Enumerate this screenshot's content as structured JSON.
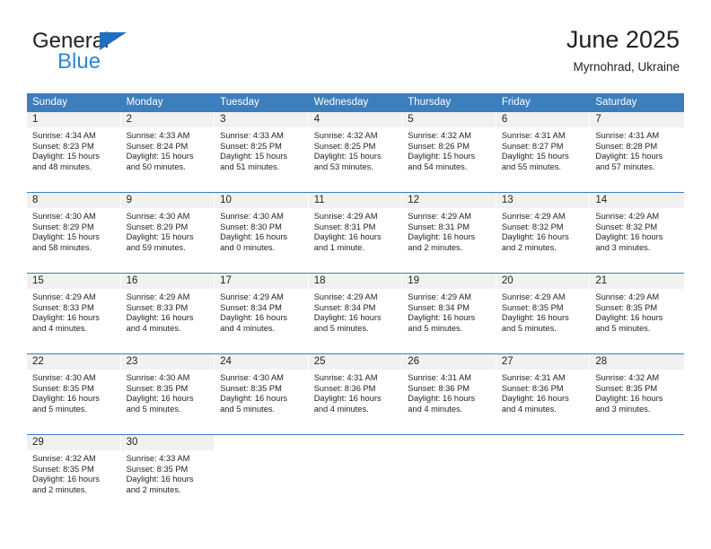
{
  "brand": {
    "name_part1": "General",
    "name_part2": "Blue",
    "triangle_icon": "brand-triangle-icon",
    "colors": {
      "dark": "#231f20",
      "blue": "#2e86d6",
      "triangle": "#1f6fc0"
    }
  },
  "header": {
    "title": "June 2025",
    "subtitle": "Myrnohrad, Ukraine"
  },
  "theme": {
    "header_blue": "#3d7ebd",
    "day_band_gray": "#f1f1f1",
    "text": "#231f20",
    "cell_background": "#ffffff"
  },
  "calendar": {
    "weekdays": [
      "Sunday",
      "Monday",
      "Tuesday",
      "Wednesday",
      "Thursday",
      "Friday",
      "Saturday"
    ],
    "weeks": [
      [
        {
          "day": "1",
          "sunrise": "Sunrise: 4:34 AM",
          "sunset": "Sunset: 8:23 PM",
          "daylight_line1": "Daylight: 15 hours",
          "daylight_line2": "and 48 minutes."
        },
        {
          "day": "2",
          "sunrise": "Sunrise: 4:33 AM",
          "sunset": "Sunset: 8:24 PM",
          "daylight_line1": "Daylight: 15 hours",
          "daylight_line2": "and 50 minutes."
        },
        {
          "day": "3",
          "sunrise": "Sunrise: 4:33 AM",
          "sunset": "Sunset: 8:25 PM",
          "daylight_line1": "Daylight: 15 hours",
          "daylight_line2": "and 51 minutes."
        },
        {
          "day": "4",
          "sunrise": "Sunrise: 4:32 AM",
          "sunset": "Sunset: 8:25 PM",
          "daylight_line1": "Daylight: 15 hours",
          "daylight_line2": "and 53 minutes."
        },
        {
          "day": "5",
          "sunrise": "Sunrise: 4:32 AM",
          "sunset": "Sunset: 8:26 PM",
          "daylight_line1": "Daylight: 15 hours",
          "daylight_line2": "and 54 minutes."
        },
        {
          "day": "6",
          "sunrise": "Sunrise: 4:31 AM",
          "sunset": "Sunset: 8:27 PM",
          "daylight_line1": "Daylight: 15 hours",
          "daylight_line2": "and 55 minutes."
        },
        {
          "day": "7",
          "sunrise": "Sunrise: 4:31 AM",
          "sunset": "Sunset: 8:28 PM",
          "daylight_line1": "Daylight: 15 hours",
          "daylight_line2": "and 57 minutes."
        }
      ],
      [
        {
          "day": "8",
          "sunrise": "Sunrise: 4:30 AM",
          "sunset": "Sunset: 8:29 PM",
          "daylight_line1": "Daylight: 15 hours",
          "daylight_line2": "and 58 minutes."
        },
        {
          "day": "9",
          "sunrise": "Sunrise: 4:30 AM",
          "sunset": "Sunset: 8:29 PM",
          "daylight_line1": "Daylight: 15 hours",
          "daylight_line2": "and 59 minutes."
        },
        {
          "day": "10",
          "sunrise": "Sunrise: 4:30 AM",
          "sunset": "Sunset: 8:30 PM",
          "daylight_line1": "Daylight: 16 hours",
          "daylight_line2": "and 0 minutes."
        },
        {
          "day": "11",
          "sunrise": "Sunrise: 4:29 AM",
          "sunset": "Sunset: 8:31 PM",
          "daylight_line1": "Daylight: 16 hours",
          "daylight_line2": "and 1 minute."
        },
        {
          "day": "12",
          "sunrise": "Sunrise: 4:29 AM",
          "sunset": "Sunset: 8:31 PM",
          "daylight_line1": "Daylight: 16 hours",
          "daylight_line2": "and 2 minutes."
        },
        {
          "day": "13",
          "sunrise": "Sunrise: 4:29 AM",
          "sunset": "Sunset: 8:32 PM",
          "daylight_line1": "Daylight: 16 hours",
          "daylight_line2": "and 2 minutes."
        },
        {
          "day": "14",
          "sunrise": "Sunrise: 4:29 AM",
          "sunset": "Sunset: 8:32 PM",
          "daylight_line1": "Daylight: 16 hours",
          "daylight_line2": "and 3 minutes."
        }
      ],
      [
        {
          "day": "15",
          "sunrise": "Sunrise: 4:29 AM",
          "sunset": "Sunset: 8:33 PM",
          "daylight_line1": "Daylight: 16 hours",
          "daylight_line2": "and 4 minutes."
        },
        {
          "day": "16",
          "sunrise": "Sunrise: 4:29 AM",
          "sunset": "Sunset: 8:33 PM",
          "daylight_line1": "Daylight: 16 hours",
          "daylight_line2": "and 4 minutes."
        },
        {
          "day": "17",
          "sunrise": "Sunrise: 4:29 AM",
          "sunset": "Sunset: 8:34 PM",
          "daylight_line1": "Daylight: 16 hours",
          "daylight_line2": "and 4 minutes."
        },
        {
          "day": "18",
          "sunrise": "Sunrise: 4:29 AM",
          "sunset": "Sunset: 8:34 PM",
          "daylight_line1": "Daylight: 16 hours",
          "daylight_line2": "and 5 minutes."
        },
        {
          "day": "19",
          "sunrise": "Sunrise: 4:29 AM",
          "sunset": "Sunset: 8:34 PM",
          "daylight_line1": "Daylight: 16 hours",
          "daylight_line2": "and 5 minutes."
        },
        {
          "day": "20",
          "sunrise": "Sunrise: 4:29 AM",
          "sunset": "Sunset: 8:35 PM",
          "daylight_line1": "Daylight: 16 hours",
          "daylight_line2": "and 5 minutes."
        },
        {
          "day": "21",
          "sunrise": "Sunrise: 4:29 AM",
          "sunset": "Sunset: 8:35 PM",
          "daylight_line1": "Daylight: 16 hours",
          "daylight_line2": "and 5 minutes."
        }
      ],
      [
        {
          "day": "22",
          "sunrise": "Sunrise: 4:30 AM",
          "sunset": "Sunset: 8:35 PM",
          "daylight_line1": "Daylight: 16 hours",
          "daylight_line2": "and 5 minutes."
        },
        {
          "day": "23",
          "sunrise": "Sunrise: 4:30 AM",
          "sunset": "Sunset: 8:35 PM",
          "daylight_line1": "Daylight: 16 hours",
          "daylight_line2": "and 5 minutes."
        },
        {
          "day": "24",
          "sunrise": "Sunrise: 4:30 AM",
          "sunset": "Sunset: 8:35 PM",
          "daylight_line1": "Daylight: 16 hours",
          "daylight_line2": "and 5 minutes."
        },
        {
          "day": "25",
          "sunrise": "Sunrise: 4:31 AM",
          "sunset": "Sunset: 8:36 PM",
          "daylight_line1": "Daylight: 16 hours",
          "daylight_line2": "and 4 minutes."
        },
        {
          "day": "26",
          "sunrise": "Sunrise: 4:31 AM",
          "sunset": "Sunset: 8:36 PM",
          "daylight_line1": "Daylight: 16 hours",
          "daylight_line2": "and 4 minutes."
        },
        {
          "day": "27",
          "sunrise": "Sunrise: 4:31 AM",
          "sunset": "Sunset: 8:36 PM",
          "daylight_line1": "Daylight: 16 hours",
          "daylight_line2": "and 4 minutes."
        },
        {
          "day": "28",
          "sunrise": "Sunrise: 4:32 AM",
          "sunset": "Sunset: 8:35 PM",
          "daylight_line1": "Daylight: 16 hours",
          "daylight_line2": "and 3 minutes."
        }
      ],
      [
        {
          "day": "29",
          "sunrise": "Sunrise: 4:32 AM",
          "sunset": "Sunset: 8:35 PM",
          "daylight_line1": "Daylight: 16 hours",
          "daylight_line2": "and 2 minutes."
        },
        {
          "day": "30",
          "sunrise": "Sunrise: 4:33 AM",
          "sunset": "Sunset: 8:35 PM",
          "daylight_line1": "Daylight: 16 hours",
          "daylight_line2": "and 2 minutes."
        },
        {
          "day": "",
          "sunrise": "",
          "sunset": "",
          "daylight_line1": "",
          "daylight_line2": ""
        },
        {
          "day": "",
          "sunrise": "",
          "sunset": "",
          "daylight_line1": "",
          "daylight_line2": ""
        },
        {
          "day": "",
          "sunrise": "",
          "sunset": "",
          "daylight_line1": "",
          "daylight_line2": ""
        },
        {
          "day": "",
          "sunrise": "",
          "sunset": "",
          "daylight_line1": "",
          "daylight_line2": ""
        },
        {
          "day": "",
          "sunrise": "",
          "sunset": "",
          "daylight_line1": "",
          "daylight_line2": ""
        }
      ]
    ]
  }
}
